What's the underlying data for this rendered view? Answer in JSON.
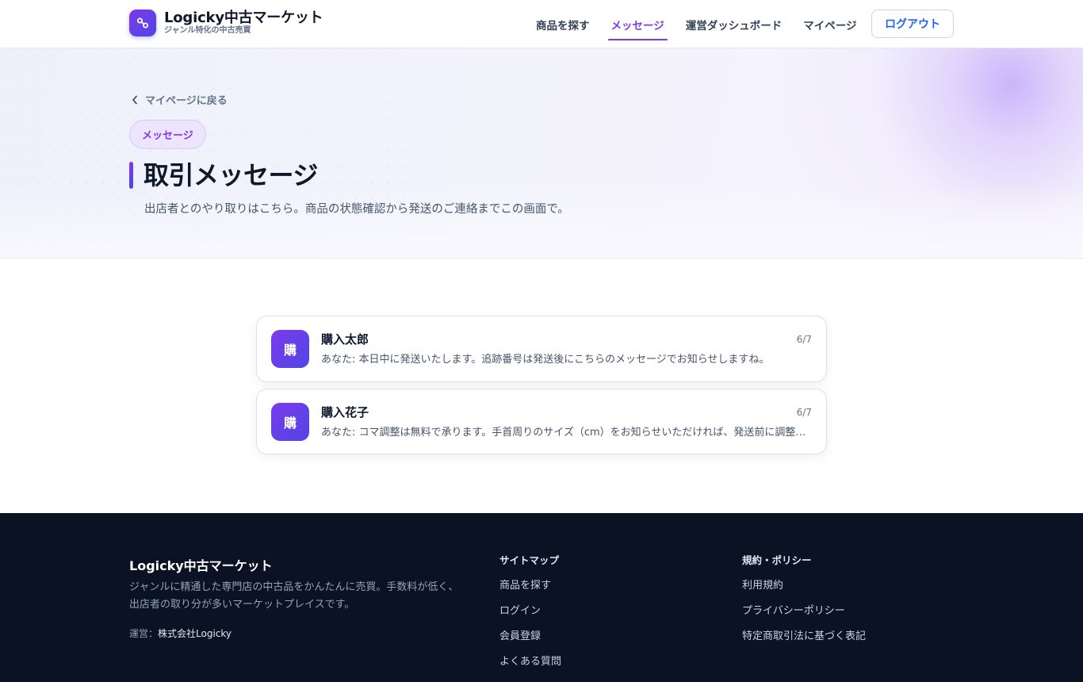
{
  "header": {
    "brand_name": "Logicky中古マーケット",
    "brand_sub": "ジャンル特化の中古売買",
    "nav": [
      {
        "label": "商品を探す"
      },
      {
        "label": "メッセージ"
      },
      {
        "label": "運営ダッシュボード"
      },
      {
        "label": "マイページ"
      }
    ],
    "active_nav": "メッセージ",
    "logout_label": "ログアウト"
  },
  "hero": {
    "back_label": "マイページに戻る",
    "badge": "メッセージ",
    "title": "取引メッセージ",
    "description": "出店者とのやり取りはこちら。商品の状態確認から発送のご連絡までこの画面で。"
  },
  "conversations": [
    {
      "avatar": "購",
      "name": "購入太郎",
      "date": "6/7",
      "message": "あなた: 本日中に発送いたします。追跡番号は発送後にこちらのメッセージでお知らせしますね。"
    },
    {
      "avatar": "購",
      "name": "購入花子",
      "date": "6/7",
      "message": "あなた: コマ調整は無料で承ります。手首周りのサイズ（cm）をお知らせいただければ、発送前に調整いたします。"
    }
  ],
  "footer": {
    "brand": "Logicky中古マーケット",
    "description": "ジャンルに精通した専門店の中古品をかんたんに売買。手数料が低く、出店者の取り分が多いマーケットプレイスです。",
    "operator_label": "運営：",
    "operator_name": "株式会社Logicky",
    "sitemap": {
      "heading": "サイトマップ",
      "links": [
        "商品を探す",
        "ログイン",
        "会員登録",
        "よくある質問"
      ]
    },
    "policy": {
      "heading": "規約・ポリシー",
      "links": [
        "利用規約",
        "プライバシーポリシー",
        "特定商取引法に基づく表記"
      ]
    }
  },
  "colors": {
    "accent": "#7c3aed",
    "accent_secondary": "#4f46e5",
    "link_blue": "#2563eb",
    "footer_bg": "#0b1224"
  },
  "icons": {
    "logo": "link-icon",
    "back": "chevron-left-icon"
  }
}
